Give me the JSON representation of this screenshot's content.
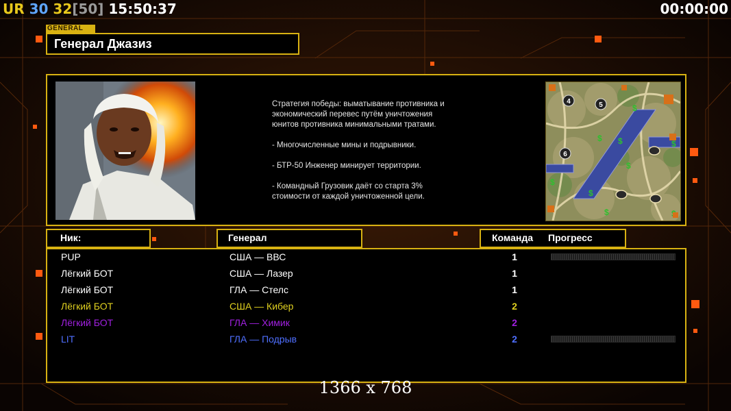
{
  "hud": {
    "ur_label": "UR",
    "fps1": "30",
    "fps2": "32",
    "fps_limit": "[50]",
    "clock": "15:50:37",
    "timer": "00:00:00",
    "colors": {
      "ur": "#e8c81c",
      "fps1": "#5fa6ff",
      "fps2": "#e8c81c",
      "limit": "#9a9a9a"
    }
  },
  "general": {
    "tag": "GENERAL",
    "name": "Генерал Джазиз",
    "description": [
      "Стратегия победы: выматывание противника и\n экономический перевес путём уничтожения\n юнитов противника минимальными тратами.",
      "- Многочисленные мины и подрывники.",
      "- БТР-50 Инженер минирует территории.",
      "- Командный Грузовик даёт со старта 3%\n стоимости от каждой уничтоженной цели."
    ],
    "portrait_icon": "general-portrait",
    "minimap_icon": "map-preview",
    "map_markers": [
      "4",
      "5",
      "6"
    ]
  },
  "table": {
    "headers": {
      "nick": "Ник:",
      "general": "Генерал",
      "team": "Команда",
      "progress": "Прогресс"
    },
    "rows": [
      {
        "nick": "PUP",
        "general": "США — ВВС",
        "team": "1",
        "color": "#ffffff",
        "progress": true
      },
      {
        "nick": "Лёгкий БОТ",
        "general": "США — Лазер",
        "team": "1",
        "color": "#ffffff",
        "progress": false
      },
      {
        "nick": "Лёгкий БОТ",
        "general": "ГЛА — Стелс",
        "team": "1",
        "color": "#ffffff",
        "progress": false
      },
      {
        "nick": "Лёгкий БОТ",
        "general": "США — Кибер",
        "team": "2",
        "color": "#e0d020",
        "progress": false
      },
      {
        "nick": "Лёгкий БОТ",
        "general": "ГЛА — Химик",
        "team": "2",
        "color": "#a020e0",
        "progress": false
      },
      {
        "nick": "LIT",
        "general": "ГЛА — Подрыв",
        "team": "2",
        "color": "#4f6fff",
        "progress": true
      }
    ]
  },
  "resolution": "1366 x 768",
  "colors": {
    "accent": "#d8b212",
    "background": "#0d0604"
  }
}
